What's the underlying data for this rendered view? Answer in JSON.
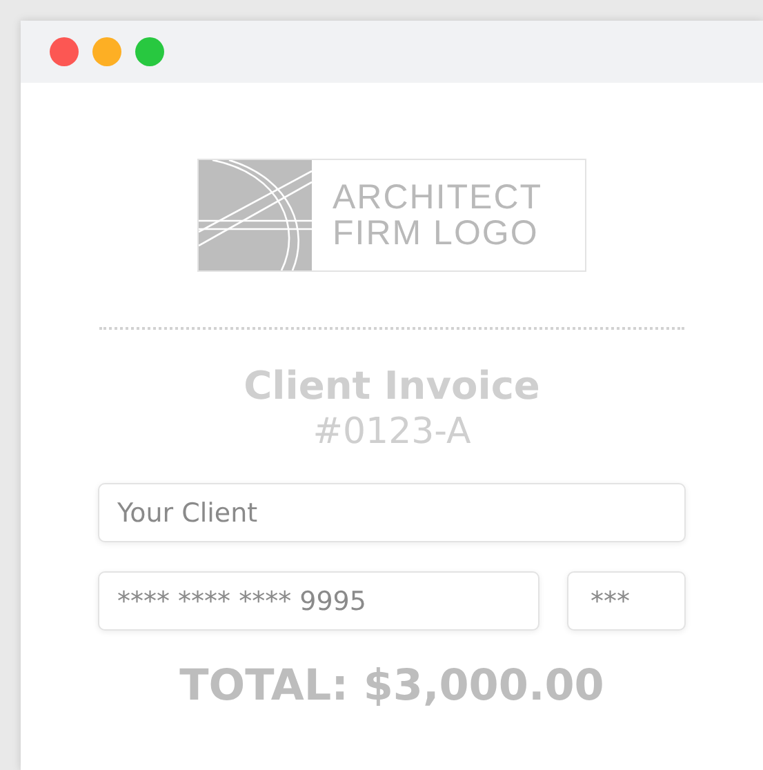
{
  "window": {
    "controls": [
      {
        "color": "#fc5753"
      },
      {
        "color": "#fdaf24"
      },
      {
        "color": "#28c840"
      }
    ]
  },
  "logo": {
    "line_1": "ARCHITECT",
    "line_2": "FIRM LOGO"
  },
  "invoice": {
    "title": "Client Invoice",
    "number": "#0123-A"
  },
  "client_field": {
    "placeholder": "Your Client"
  },
  "card_field": {
    "value": "**** **** **** 9995"
  },
  "cvv_field": {
    "value": "***"
  },
  "total": "TOTAL: $3,000.00"
}
